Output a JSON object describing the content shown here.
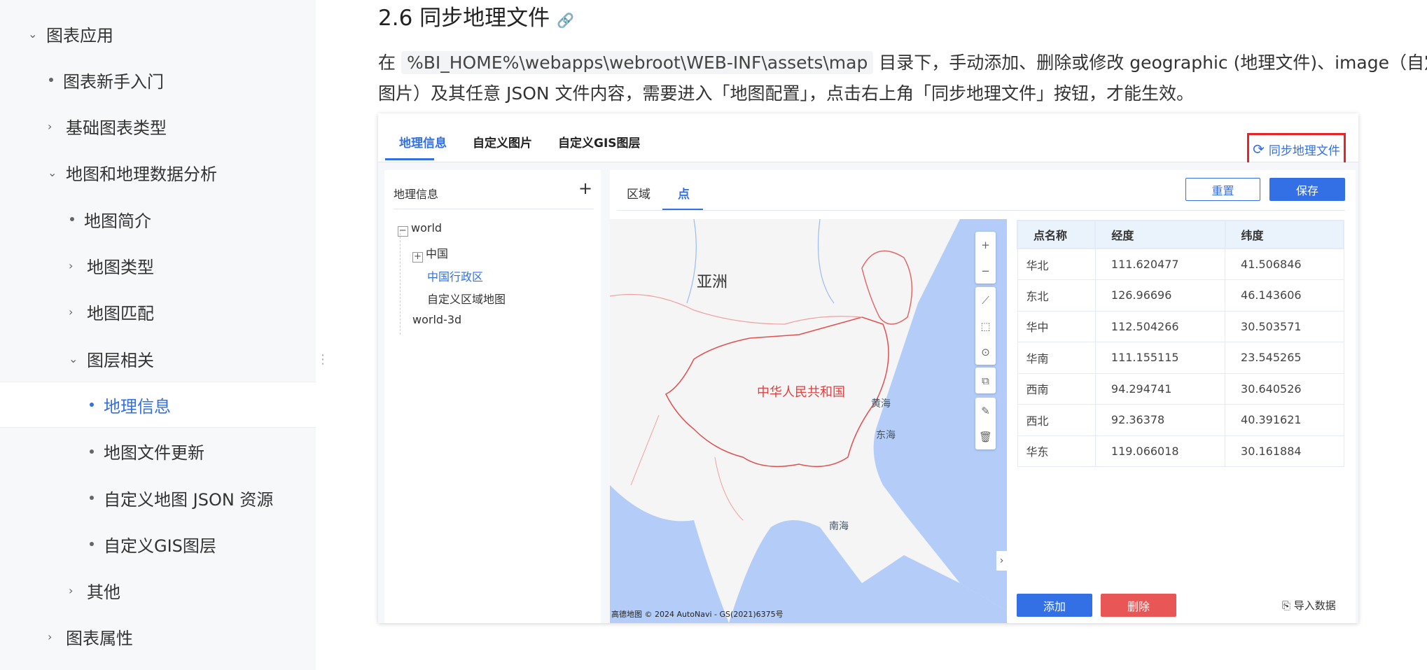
{
  "sidebar": {
    "items": [
      {
        "label": "图表应用",
        "type": "chevron-down"
      },
      {
        "label": "图表新手入门",
        "type": "dot"
      },
      {
        "label": "基础图表类型",
        "type": "chevron-right"
      },
      {
        "label": "地图和地理数据分析",
        "type": "chevron-down"
      },
      {
        "label": "地图简介",
        "type": "dot"
      },
      {
        "label": "地图类型",
        "type": "chevron-right"
      },
      {
        "label": "地图匹配",
        "type": "chevron-right"
      },
      {
        "label": "图层相关",
        "type": "chevron-down"
      },
      {
        "label": "地理信息",
        "type": "dot",
        "active": true
      },
      {
        "label": "地图文件更新",
        "type": "dot"
      },
      {
        "label": "自定义地图 JSON 资源",
        "type": "dot"
      },
      {
        "label": "自定义GIS图层",
        "type": "dot"
      },
      {
        "label": "其他",
        "type": "chevron-right"
      },
      {
        "label": "图表属性",
        "type": "chevron-right"
      }
    ]
  },
  "article": {
    "heading": "2.6 同步地理文件",
    "p1_pre": "在",
    "p1_code": "%BI_HOME%\\webapps\\webroot\\WEB-INF\\assets\\map",
    "p1_post": "目录下，手动添加、删除或修改 geographic (地理文件)、image（自定义",
    "p2": "图片）及其任意 JSON 文件内容，需要进入「地图配置」，点击右上角「同步地理文件」按钮，才能生效。"
  },
  "app": {
    "tabs": [
      "地理信息",
      "自定义图片",
      "自定义GIS图层"
    ],
    "sync_button": "同步地理文件",
    "left_title": "地理信息",
    "tree": [
      "world",
      "中国",
      "中国行政区",
      "自定义区域地图",
      "world-3d"
    ],
    "sub_tabs": [
      "区域",
      "点"
    ],
    "reset": "重置",
    "save": "保存",
    "map_labels": {
      "asia": "亚洲",
      "china": "中华人民共和国",
      "yellow_sea": "黄海",
      "east_sea": "东海",
      "south_sea": "南海"
    },
    "map_attribution": "高德地图 © 2024 AutoNavi - GS(2021)6375号",
    "table": {
      "headers": [
        "点名称",
        "经度",
        "纬度"
      ],
      "rows": [
        [
          "华北",
          "111.620477",
          "41.506846"
        ],
        [
          "东北",
          "126.96696",
          "46.143606"
        ],
        [
          "华中",
          "112.504266",
          "30.503571"
        ],
        [
          "华南",
          "111.155115",
          "23.545265"
        ],
        [
          "西南",
          "94.294741",
          "30.640526"
        ],
        [
          "西北",
          "92.36378",
          "40.391621"
        ],
        [
          "华东",
          "119.066018",
          "30.161884"
        ]
      ]
    },
    "add": "添加",
    "delete": "删除",
    "import": "导入数据",
    "colors": {
      "accent": "#3370e6",
      "danger": "#e85656",
      "highlight": "#e8232a"
    }
  }
}
